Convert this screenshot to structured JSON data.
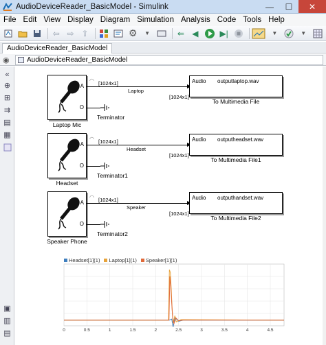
{
  "window": {
    "title": "AudioDeviceReader_BasicModel - Simulink",
    "minimize_label": "—",
    "maximize_label": "☐",
    "close_label": "✕"
  },
  "menu": [
    "File",
    "Edit",
    "View",
    "Display",
    "Diagram",
    "Simulation",
    "Analysis",
    "Code",
    "Tools",
    "Help"
  ],
  "tab": {
    "label": "AudioDeviceReader_BasicModel"
  },
  "address": {
    "path": "AudioDeviceReader_BasicModel"
  },
  "blocks": [
    {
      "name": "Laptop Mic",
      "port_a": "A",
      "port_o": "O",
      "terminator": "Terminator",
      "signal_dim": "[1024x1]",
      "signal_name": "Laptop",
      "out_dim": "[1024x1]",
      "sink_port": "Audio",
      "sink_file": "outputlaptop.wav",
      "sink_name": "To Multimedia File"
    },
    {
      "name": "Headset",
      "port_a": "A",
      "port_o": "O",
      "terminator": "Terminator1",
      "signal_dim": "[1024x1]",
      "signal_name": "Headset",
      "out_dim": "[1024x1]",
      "sink_port": "Audio",
      "sink_file": "outputheadset.wav",
      "sink_name": "To Multimedia File1"
    },
    {
      "name": "Speaker Phone",
      "port_a": "A",
      "port_o": "O",
      "terminator": "Terminator2",
      "signal_dim": "[1024x1]",
      "signal_name": "Speaker",
      "out_dim": "[1024x1]",
      "sink_port": "Audio",
      "sink_file": "outputhandset.wav",
      "sink_name": "To Multimedia File2"
    }
  ],
  "colors": {
    "headset": "#3f7fbf",
    "laptop": "#e8a33a",
    "speaker": "#e06a3a",
    "title_bar": "#c9dcf2",
    "close": "#c7463a"
  },
  "chart_data": {
    "type": "line",
    "legend": [
      "Headset[1](1)",
      "Laptop[1](1)",
      "Speaker[1](1)"
    ],
    "xlim": [
      0,
      4.8
    ],
    "x_ticks": [
      "0",
      "0.5",
      "1",
      "1.5",
      "2",
      "2.5",
      "3",
      "3.5",
      "4",
      "4.5"
    ],
    "ylim": [
      -0.1,
      1.0
    ],
    "grid": true,
    "legend_position": "top-left",
    "series": [
      {
        "name": "Headset[1](1)",
        "points": [
          [
            0,
            0
          ],
          [
            2.3,
            0
          ],
          [
            2.35,
            0.02
          ],
          [
            2.38,
            -0.12
          ],
          [
            2.42,
            0.05
          ],
          [
            2.5,
            -0.02
          ],
          [
            2.6,
            0
          ],
          [
            4.8,
            0
          ]
        ]
      },
      {
        "name": "Laptop[1](1)",
        "points": [
          [
            0,
            0
          ],
          [
            2.28,
            0
          ],
          [
            2.3,
            0.9
          ],
          [
            2.32,
            0.85
          ],
          [
            2.34,
            0.55
          ],
          [
            2.36,
            0.2
          ],
          [
            2.38,
            -0.05
          ],
          [
            2.42,
            0.08
          ],
          [
            2.45,
            -0.03
          ],
          [
            2.55,
            0.01
          ],
          [
            4.8,
            0
          ]
        ]
      },
      {
        "name": "Speaker[1](1)",
        "points": [
          [
            0,
            0
          ],
          [
            2.29,
            0
          ],
          [
            2.31,
            0.78
          ],
          [
            2.33,
            0.6
          ],
          [
            2.35,
            0.3
          ],
          [
            2.37,
            0.05
          ],
          [
            2.4,
            -0.06
          ],
          [
            2.44,
            0.04
          ],
          [
            2.5,
            -0.01
          ],
          [
            2.6,
            0
          ],
          [
            4.8,
            0
          ]
        ]
      }
    ]
  }
}
